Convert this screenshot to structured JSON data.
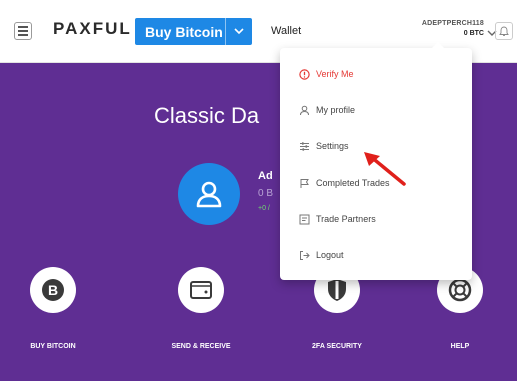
{
  "header": {
    "logo": "PAXFUL",
    "buy_button_label": "Buy Bitcoin",
    "wallet_label": "Wallet",
    "username": "ADEPTPERCH118",
    "balance": "0 BTC"
  },
  "dashboard": {
    "title": "Classic Da",
    "user_name": "Ad",
    "user_balance": "0 B",
    "user_stats": "+0 /"
  },
  "actions": [
    {
      "label": "BUY BITCOIN",
      "icon": "bitcoin-icon"
    },
    {
      "label": "SEND & RECEIVE",
      "icon": "wallet-icon"
    },
    {
      "label": "2FA SECURITY",
      "icon": "shield-icon"
    },
    {
      "label": "HELP",
      "icon": "lifebuoy-icon"
    }
  ],
  "menu": {
    "items": [
      {
        "label": "Verify Me",
        "icon": "alert-icon"
      },
      {
        "label": "My profile",
        "icon": "user-icon"
      },
      {
        "label": "Settings",
        "icon": "sliders-icon"
      },
      {
        "label": "Completed Trades",
        "icon": "flag-icon"
      },
      {
        "label": "Trade Partners",
        "icon": "partners-icon"
      },
      {
        "label": "Logout",
        "icon": "logout-icon"
      }
    ]
  },
  "colors": {
    "brand_blue": "#1e88e5",
    "panel_purple": "#5f2e93",
    "warning_red": "#e53935",
    "pointer_red": "#e0201b"
  }
}
